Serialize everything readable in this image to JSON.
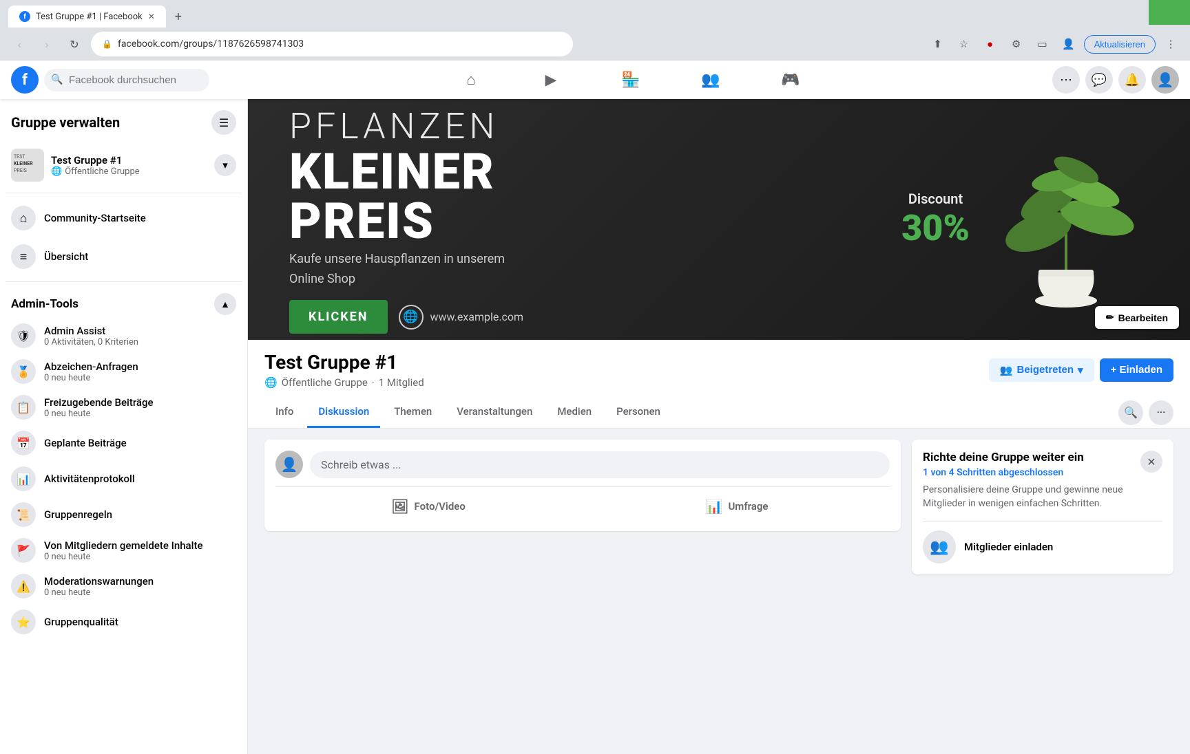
{
  "browser": {
    "tab_title": "Test Gruppe #1 | Facebook",
    "url": "facebook.com/groups/1187626598741303",
    "new_tab_icon": "+",
    "back_icon": "‹",
    "forward_icon": "›",
    "refresh_icon": "↻",
    "update_btn_label": "Aktualisieren"
  },
  "facebook": {
    "logo": "f",
    "search_placeholder": "Facebook durchsuchen",
    "nav_items": [
      {
        "id": "home",
        "icon": "⌂",
        "active": false
      },
      {
        "id": "watch",
        "icon": "▶",
        "active": false
      },
      {
        "id": "marketplace",
        "icon": "🏪",
        "active": false
      },
      {
        "id": "groups",
        "icon": "👥",
        "active": false
      },
      {
        "id": "gaming",
        "icon": "🎮",
        "active": false
      }
    ]
  },
  "sidebar": {
    "title": "Gruppe verwalten",
    "group": {
      "name": "Test Gruppe #1",
      "type": "Öffentliche Gruppe"
    },
    "nav": [
      {
        "id": "community",
        "label": "Community-Startseite",
        "icon": "⌂"
      },
      {
        "id": "overview",
        "label": "Übersicht",
        "icon": "≡"
      }
    ],
    "admin_section": "Admin-Tools",
    "admin_items": [
      {
        "id": "admin-assist",
        "name": "Admin Assist",
        "sub": "0 Aktivitäten, 0 Kriterien"
      },
      {
        "id": "badges",
        "name": "Abzeichen-Anfragen",
        "sub": "0 neu heute"
      },
      {
        "id": "pending",
        "name": "Freizugebende Beiträge",
        "sub": "0 neu heute"
      },
      {
        "id": "scheduled",
        "name": "Geplante Beiträge",
        "sub": ""
      },
      {
        "id": "activity",
        "name": "Aktivitätenprotokoll",
        "sub": ""
      },
      {
        "id": "rules",
        "name": "Gruppenregeln",
        "sub": ""
      },
      {
        "id": "reported",
        "name": "Von Mitgliedern gemeldete Inhalte",
        "sub": "0 neu heute"
      },
      {
        "id": "warnings",
        "name": "Moderationswarnungen",
        "sub": "0 neu heute"
      },
      {
        "id": "quality",
        "name": "Gruppenqualität",
        "sub": ""
      }
    ]
  },
  "cover": {
    "pflanzen": "PFLANZEN",
    "kleiner": "KLEINER",
    "preis": "PREIS",
    "subtitle1": "Kaufe unsere Hauspflanzen in unserem",
    "subtitle2": "Online Shop",
    "klicken": "KLICKEN",
    "website": "www.example.com",
    "discount_label": "Discount",
    "discount_value": "30%",
    "edit_btn": "Bearbeiten"
  },
  "group": {
    "name": "Test Gruppe #1",
    "type": "Öffentliche Gruppe",
    "members": "1 Mitglied",
    "tabs": [
      {
        "id": "info",
        "label": "Info",
        "active": false
      },
      {
        "id": "diskussion",
        "label": "Diskussion",
        "active": true
      },
      {
        "id": "themen",
        "label": "Themen",
        "active": false
      },
      {
        "id": "veranstaltungen",
        "label": "Veranstaltungen",
        "active": false
      },
      {
        "id": "medien",
        "label": "Medien",
        "active": false
      },
      {
        "id": "personen",
        "label": "Personen",
        "active": false
      }
    ],
    "joined_label": "Beigetreten",
    "invite_label": "+ Einladen"
  },
  "post_box": {
    "placeholder": "Schreib etwas ...",
    "photo_label": "Foto/Video",
    "survey_label": "Umfrage"
  },
  "setup_panel": {
    "title": "Richte deine Gruppe weiter ein",
    "progress": "1 von 4 Schritten abgeschlossen",
    "desc": "Personalisiere deine Gruppe und gewinne neue Mitglieder in wenigen einfachen Schritten.",
    "member_item": "Mitglieder einladen"
  }
}
